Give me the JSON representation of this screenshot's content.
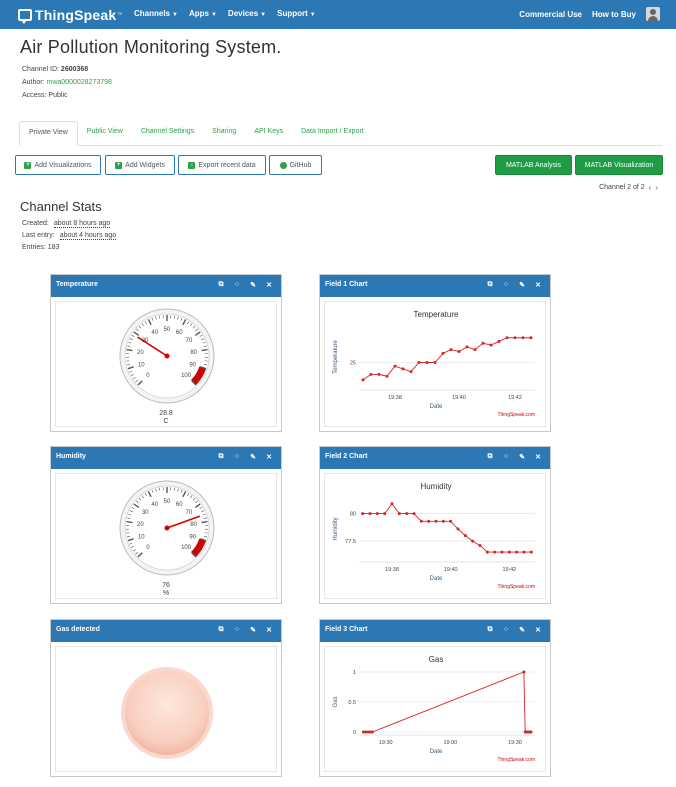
{
  "nav": {
    "brand": "ThingSpeak",
    "brand_tm": "™",
    "menus": [
      "Channels",
      "Apps",
      "Devices",
      "Support"
    ],
    "right_links": [
      "Commercial Use",
      "How to Buy"
    ]
  },
  "channel": {
    "title": "Air Pollution Monitoring System.",
    "id_label": "Channel ID:",
    "id_value": "2600368",
    "author_label": "Author:",
    "author_value": "mwa0000028273798",
    "access_label": "Access:",
    "access_value": "Public"
  },
  "tabs": [
    "Private View",
    "Public View",
    "Channel Settings",
    "Sharing",
    "API Keys",
    "Data Import / Export"
  ],
  "buttons": {
    "add_viz": "Add Visualizations",
    "add_widgets": "Add Widgets",
    "export": "Export recent data",
    "github": "GitHub",
    "matlab_analysis": "MATLAB Analysis",
    "matlab_viz": "MATLAB Visualization"
  },
  "pager": {
    "text": "Channel 2 of 2"
  },
  "stats": {
    "title": "Channel Stats",
    "created_label": "Created:",
    "created_value": "about 8 hours ago",
    "last_label": "Last entry:",
    "last_value": "about 4 hours ago",
    "entries_label": "Entries:",
    "entries_value": "183"
  },
  "widgets": {
    "temp_gauge": {
      "title": "Temperature",
      "value": "28.8",
      "unit": "C",
      "level": 28.8
    },
    "hum_gauge": {
      "title": "Humidity",
      "value": "76",
      "unit": "%",
      "level": 76
    },
    "gas": {
      "title": "Gas detected"
    },
    "chart1": {
      "header": "Field 1 Chart"
    },
    "chart2": {
      "header": "Field 2 Chart"
    },
    "chart3": {
      "header": "Field 3 Chart"
    }
  },
  "gauge_ticks": [
    "0",
    "10",
    "20",
    "30",
    "40",
    "50",
    "60",
    "70",
    "80",
    "90",
    "100"
  ],
  "colors": {
    "nav": "#2b78b4",
    "accent_green": "#1e9d45",
    "series": "#d62728"
  },
  "chart_data": [
    {
      "type": "line",
      "title": "Temperature",
      "xlabel": "Date",
      "ylabel": "Temperature",
      "ytick_labels": [
        "25"
      ],
      "xtick_labels": [
        "19:38",
        "19:40",
        "19:42"
      ],
      "credit": "ThingSpeak.com",
      "ylim": [
        22,
        29.2
      ],
      "y_tick_value": 25,
      "x": [
        0,
        1,
        2,
        3,
        4,
        5,
        6,
        7,
        8,
        9,
        10,
        11,
        12,
        13,
        14,
        15,
        16,
        17,
        18,
        19,
        20,
        21
      ],
      "xlim": [
        -0.5,
        21.5
      ],
      "values": [
        23.1,
        23.7,
        23.7,
        23.5,
        24.6,
        24.3,
        24.0,
        25.0,
        25.0,
        25.0,
        26.0,
        26.4,
        26.2,
        26.7,
        26.4,
        27.1,
        26.9,
        27.3,
        27.7,
        27.7,
        27.7,
        27.7
      ],
      "xtick_positions": [
        4,
        12,
        19
      ]
    },
    {
      "type": "line",
      "title": "Humidity",
      "xlabel": "Date",
      "ylabel": "Humidity",
      "ytick_labels": [
        "80",
        "77.5"
      ],
      "xtick_labels": [
        "19:38",
        "19:40",
        "19:42"
      ],
      "credit": "ThingSpeak.com",
      "ylim": [
        75.6,
        81.6
      ],
      "ytick_values": [
        80,
        77.5
      ],
      "x": [
        0,
        1,
        2,
        3,
        4,
        5,
        6,
        7,
        8,
        9,
        10,
        11,
        12,
        13,
        14,
        15,
        16,
        17,
        18,
        19,
        20,
        21,
        22,
        23
      ],
      "xlim": [
        -0.5,
        23.5
      ],
      "values": [
        80,
        80,
        80,
        80,
        80.9,
        80,
        80,
        80,
        79.3,
        79.3,
        79.3,
        79.3,
        79.3,
        78.6,
        78.0,
        77.5,
        77.1,
        76.5,
        76.5,
        76.5,
        76.5,
        76.5,
        76.5,
        76.5
      ],
      "xtick_positions": [
        4,
        12,
        20
      ]
    },
    {
      "type": "line",
      "title": "Gas",
      "xlabel": "Date",
      "ylabel": "Gas",
      "ytick_labels": [
        "1",
        "0.5",
        "0"
      ],
      "xtick_labels": [
        "19:30",
        "19:00",
        "19:30"
      ],
      "credit": "ThingSpeak.com",
      "ylim": [
        -0.05,
        1.05
      ],
      "ytick_values": [
        1,
        0.5,
        0
      ],
      "x": [
        0,
        0.5,
        1,
        1.5,
        2,
        36,
        36.3,
        36.6,
        37,
        37.3,
        37.6
      ],
      "xlim": [
        -1,
        38.5
      ],
      "values": [
        0,
        0,
        0,
        0,
        0,
        1,
        0,
        0,
        0,
        0,
        0
      ],
      "xtick_positions": [
        5,
        19.5,
        34
      ]
    }
  ]
}
